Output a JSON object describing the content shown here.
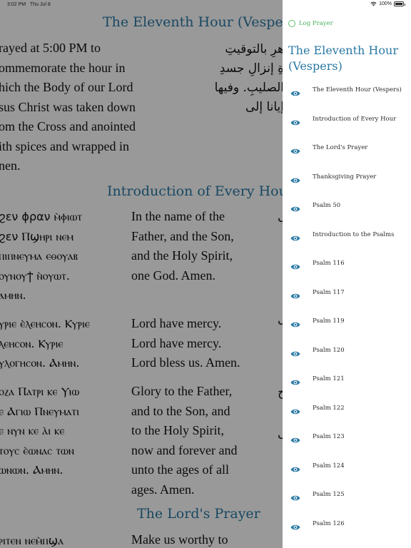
{
  "status_bar": {
    "time": "3:02 PM",
    "date": "Thu Jul 8",
    "wifi_icon": "wifi-icon",
    "battery": "100%",
    "battery_level": 1.0
  },
  "reader": {
    "sections": [
      {
        "title": "The Eleventh Hour (Vespers)"
      },
      {
        "title": "Introduction of Every Hour"
      },
      {
        "title": "The Lord's Prayer"
      }
    ],
    "vespers": {
      "english": [
        "rayed at 5:00 PM to",
        "ommemorate the hour in",
        "hich the Body of our Lord",
        "sus Christ was taken down",
        "om the Cross and anointed",
        "ith spices and wrapped in",
        "nen."
      ],
      "arabic": [
        "ُهرِ بالتوقيتِ",
        "ِةِ إنزالِ جسدِ",
        "الصليبِ. وفيها",
        "إيانا إلى"
      ]
    },
    "intro_blocks": [
      {
        "coptic": [
          "ϩεν ϕραν ⲙ̀ⲫⲓⲱⲧ",
          "ϩεν Ⲡϣⲏⲣⲓ ⲛⲉⲙ",
          "ⲡⲓⲡⲛⲉⲩⲙⲁ ⲉⲑⲟⲩⲁⲃ",
          "ⲟⲩⲛⲟⲩϯ ⲛ̀ⲟⲩⲱⲧ.",
          "ⲁⲙⲏⲛ."
        ],
        "english": [
          "In the name of the",
          "Father, and the Son,",
          "and the Holy Spirit,",
          "one God. Amen."
        ]
      },
      {
        "coptic": [
          "ⲩⲣⲓⲉ ⲉ̀ⲗⲉⲏⲥⲟⲛ. Ⲕⲩⲣⲓⲉ",
          "ⲗⲉⲏⲥⲟⲛ. Ⲕⲩⲣⲓⲉ",
          "ⲩⲗⲟⲅⲏⲥⲟⲛ. Ⲁⲙⲏⲛ."
        ],
        "english": [
          "Lord have mercy.",
          "Lord have mercy.",
          "Lord bless us. Amen."
        ]
      },
      {
        "coptic": [
          "ⲟⲍⲁ Ⲡⲁⲧⲣⲓ ⲕⲉ Ⲩⲓⲱ",
          "ⲉ Ⲁⲅⲓⲱ Ⲡⲛⲉⲩⲙⲁⲧⲓ",
          "ⲉ ⲛⲩⲛ ⲕⲉ ⲁ̀ⲓ ⲕⲉ",
          "ⲧⲟⲩⲥ ⲉ̀ⲱⲛⲁⲥ ⲧⲱⲛ",
          "ⲱⲛⲱⲛ. Ⲁⲙⲏⲛ."
        ],
        "english": [
          "Glory to the Father,",
          "and to the Son, and",
          "to the Holy Spirit,",
          "now and forever and",
          "unto the ages of all",
          "ages. Amen."
        ]
      }
    ],
    "lords_prayer": {
      "coptic": [
        "ⲣⲓⲧⲉⲛ ⲛⲉⲙ̀ⲡϣⲁ"
      ],
      "english": [
        "Make us worthy to"
      ]
    },
    "arabic_stubs": [
      "ب",
      "ب",
      "ح",
      "ب"
    ]
  },
  "drawer": {
    "log_prayer_label": "Log Prayer",
    "title": "The Eleventh Hour (Vespers)",
    "items": [
      {
        "label": "The Eleventh Hour (Vespers)",
        "icon": "eye-icon"
      },
      {
        "label": "Introduction of Every Hour",
        "icon": "eye-icon"
      },
      {
        "label": "The Lord's Prayer",
        "icon": "eye-icon"
      },
      {
        "label": "Thanksgiving Prayer",
        "icon": "eye-icon"
      },
      {
        "label": "Psalm 50",
        "icon": "eye-icon"
      },
      {
        "label": "Introduction to the Psalms",
        "icon": "eye-icon"
      },
      {
        "label": "Psalm 116",
        "icon": "eye-icon"
      },
      {
        "label": "Psalm 117",
        "icon": "eye-icon"
      },
      {
        "label": "Psalm 119",
        "icon": "eye-icon"
      },
      {
        "label": "Psalm 120",
        "icon": "eye-icon"
      },
      {
        "label": "Psalm 121",
        "icon": "eye-icon"
      },
      {
        "label": "Psalm 122",
        "icon": "eye-icon"
      },
      {
        "label": "Psalm 123",
        "icon": "eye-icon"
      },
      {
        "label": "Psalm 124",
        "icon": "eye-icon"
      },
      {
        "label": "Psalm 125",
        "icon": "eye-icon"
      },
      {
        "label": "Psalm 126",
        "icon": "eye-icon"
      }
    ]
  },
  "colors": {
    "accent": "#2a79a3",
    "log_green": "#4caf60",
    "overlay": "rgba(0,0,0,0.40)"
  }
}
